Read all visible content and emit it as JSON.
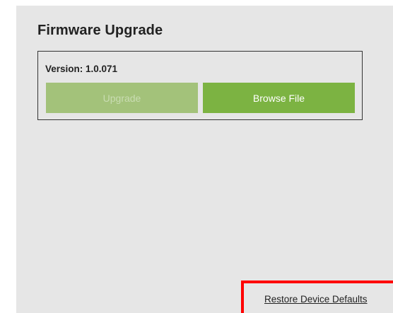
{
  "firmware": {
    "title": "Firmware Upgrade",
    "version_label": "Version: 1.0.071",
    "upgrade_label": "Upgrade",
    "upgrade_enabled": false,
    "browse_label": "Browse File"
  },
  "footer": {
    "restore_label": "Restore Device Defaults"
  },
  "colors": {
    "panel_bg": "#e6e6e6",
    "accent_green": "#7cb342",
    "disabled_green": "#a3c27a",
    "highlight_red": "#ff0000"
  }
}
